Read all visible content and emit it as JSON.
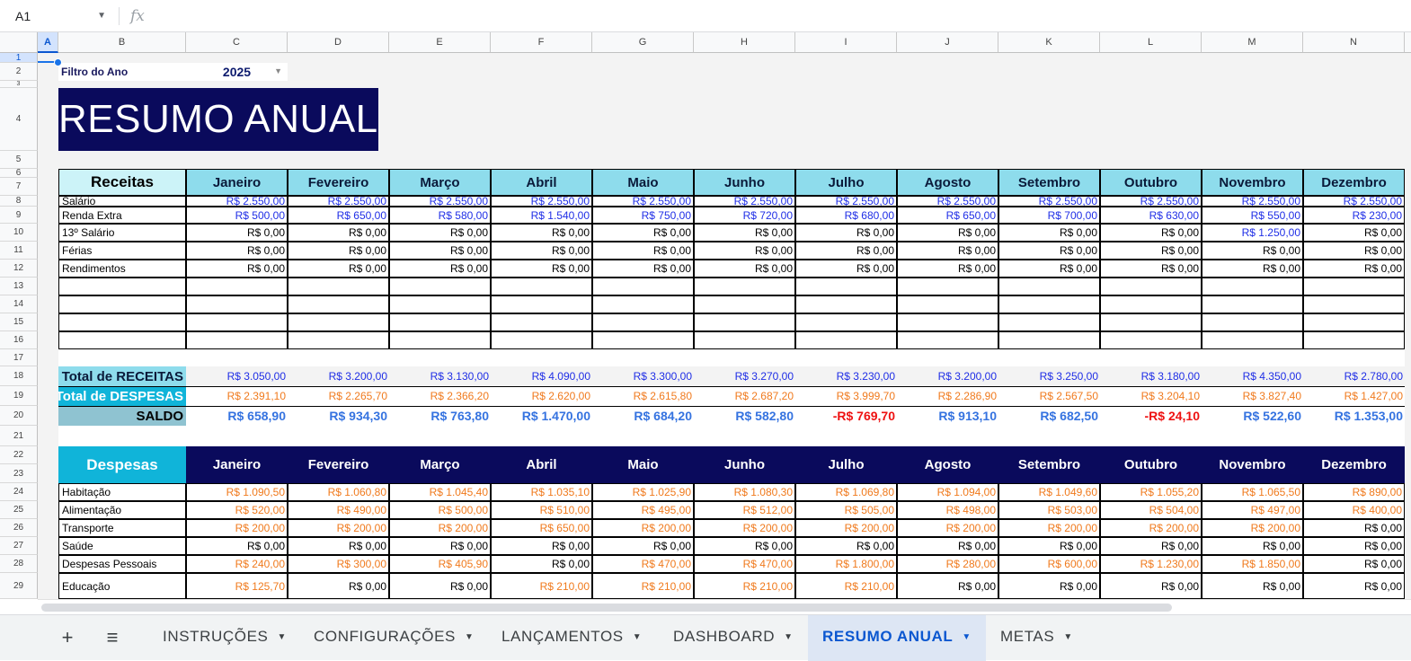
{
  "formula_bar": {
    "cell_ref": "A1",
    "fx_icon": "fx"
  },
  "columns": [
    "A",
    "B",
    "C",
    "D",
    "E",
    "F",
    "G",
    "H",
    "I",
    "J",
    "K",
    "L",
    "M",
    "N"
  ],
  "rows": [
    "1",
    "2",
    "3",
    "4",
    "5",
    "6",
    "7",
    "8",
    "9",
    "10",
    "11",
    "12",
    "13",
    "14",
    "15",
    "16",
    "17",
    "18",
    "19",
    "20",
    "21",
    "22",
    "23",
    "24",
    "25",
    "26",
    "27",
    "28",
    "29"
  ],
  "filter": {
    "label": "Filtro do Ano",
    "value": "2025"
  },
  "title": "RESUMO ANUAL",
  "months": [
    "Janeiro",
    "Fevereiro",
    "Março",
    "Abril",
    "Maio",
    "Junho",
    "Julho",
    "Agosto",
    "Setembro",
    "Outubro",
    "Novembro",
    "Dezembro"
  ],
  "receitas": {
    "header": "Receitas",
    "rows": [
      {
        "label": "Salário",
        "values": [
          "R$ 2.550,00",
          "R$ 2.550,00",
          "R$ 2.550,00",
          "R$ 2.550,00",
          "R$ 2.550,00",
          "R$ 2.550,00",
          "R$ 2.550,00",
          "R$ 2.550,00",
          "R$ 2.550,00",
          "R$ 2.550,00",
          "R$ 2.550,00",
          "R$ 2.550,00"
        ]
      },
      {
        "label": "Renda Extra",
        "values": [
          "R$ 500,00",
          "R$ 650,00",
          "R$ 580,00",
          "R$ 1.540,00",
          "R$ 750,00",
          "R$ 720,00",
          "R$ 680,00",
          "R$ 650,00",
          "R$ 700,00",
          "R$ 630,00",
          "R$ 550,00",
          "R$ 230,00"
        ]
      },
      {
        "label": "13º Salário",
        "values": [
          "R$ 0,00",
          "R$ 0,00",
          "R$ 0,00",
          "R$ 0,00",
          "R$ 0,00",
          "R$ 0,00",
          "R$ 0,00",
          "R$ 0,00",
          "R$ 0,00",
          "R$ 0,00",
          "R$ 1.250,00",
          "R$ 0,00"
        ]
      },
      {
        "label": "Férias",
        "values": [
          "R$ 0,00",
          "R$ 0,00",
          "R$ 0,00",
          "R$ 0,00",
          "R$ 0,00",
          "R$ 0,00",
          "R$ 0,00",
          "R$ 0,00",
          "R$ 0,00",
          "R$ 0,00",
          "R$ 0,00",
          "R$ 0,00"
        ]
      },
      {
        "label": "Rendimentos",
        "values": [
          "R$ 0,00",
          "R$ 0,00",
          "R$ 0,00",
          "R$ 0,00",
          "R$ 0,00",
          "R$ 0,00",
          "R$ 0,00",
          "R$ 0,00",
          "R$ 0,00",
          "R$ 0,00",
          "R$ 0,00",
          "R$ 0,00"
        ]
      }
    ]
  },
  "totals": {
    "receitas_label": "Total de RECEITAS",
    "receitas": [
      "R$ 3.050,00",
      "R$ 3.200,00",
      "R$ 3.130,00",
      "R$ 4.090,00",
      "R$ 3.300,00",
      "R$ 3.270,00",
      "R$ 3.230,00",
      "R$ 3.200,00",
      "R$ 3.250,00",
      "R$ 3.180,00",
      "R$ 4.350,00",
      "R$ 2.780,00"
    ],
    "despesas_label": "Total de DESPESAS",
    "despesas": [
      "R$ 2.391,10",
      "R$ 2.265,70",
      "R$ 2.366,20",
      "R$ 2.620,00",
      "R$ 2.615,80",
      "R$ 2.687,20",
      "R$ 3.999,70",
      "R$ 2.286,90",
      "R$ 2.567,50",
      "R$ 3.204,10",
      "R$ 3.827,40",
      "R$ 1.427,00"
    ],
    "saldo_label": "SALDO",
    "saldo": [
      "R$ 658,90",
      "R$ 934,30",
      "R$ 763,80",
      "R$ 1.470,00",
      "R$ 684,20",
      "R$ 582,80",
      "-R$ 769,70",
      "R$ 913,10",
      "R$ 682,50",
      "-R$ 24,10",
      "R$ 522,60",
      "R$ 1.353,00"
    ]
  },
  "despesas": {
    "header": "Despesas",
    "rows": [
      {
        "label": "Habitação",
        "values": [
          "R$ 1.090,50",
          "R$ 1.060,80",
          "R$ 1.045,40",
          "R$ 1.035,10",
          "R$ 1.025,90",
          "R$ 1.080,30",
          "R$ 1.069,80",
          "R$ 1.094,00",
          "R$ 1.049,60",
          "R$ 1.055,20",
          "R$ 1.065,50",
          "R$ 890,00"
        ]
      },
      {
        "label": "Alimentação",
        "values": [
          "R$ 520,00",
          "R$ 490,00",
          "R$ 500,00",
          "R$ 510,00",
          "R$ 495,00",
          "R$ 512,00",
          "R$ 505,00",
          "R$ 498,00",
          "R$ 503,00",
          "R$ 504,00",
          "R$ 497,00",
          "R$ 400,00"
        ]
      },
      {
        "label": "Transporte",
        "values": [
          "R$ 200,00",
          "R$ 200,00",
          "R$ 200,00",
          "R$ 650,00",
          "R$ 200,00",
          "R$ 200,00",
          "R$ 200,00",
          "R$ 200,00",
          "R$ 200,00",
          "R$ 200,00",
          "R$ 200,00",
          "R$ 0,00"
        ]
      },
      {
        "label": "Saúde",
        "values": [
          "R$ 0,00",
          "R$ 0,00",
          "R$ 0,00",
          "R$ 0,00",
          "R$ 0,00",
          "R$ 0,00",
          "R$ 0,00",
          "R$ 0,00",
          "R$ 0,00",
          "R$ 0,00",
          "R$ 0,00",
          "R$ 0,00"
        ]
      },
      {
        "label": "Despesas Pessoais",
        "values": [
          "R$ 240,00",
          "R$ 300,00",
          "R$ 405,90",
          "R$ 0,00",
          "R$ 470,00",
          "R$ 470,00",
          "R$ 1.800,00",
          "R$ 280,00",
          "R$ 600,00",
          "R$ 1.230,00",
          "R$ 1.850,00",
          "R$ 0,00"
        ]
      },
      {
        "label": "Educação",
        "values": [
          "R$ 125,70",
          "R$ 0,00",
          "R$ 0,00",
          "R$ 210,00",
          "R$ 210,00",
          "R$ 210,00",
          "R$ 210,00",
          "R$ 0,00",
          "R$ 0,00",
          "R$ 0,00",
          "R$ 0,00",
          "R$ 0,00"
        ]
      }
    ]
  },
  "tabs": {
    "add_icon": "+",
    "menu_icon": "≡",
    "items": [
      "INSTRUÇÕES",
      "CONFIGURAÇÕES",
      "LANÇAMENTOS",
      "DASHBOARD",
      "RESUMO ANUAL",
      "METAS"
    ],
    "active": "RESUMO ANUAL"
  },
  "colors": {
    "banner": "#0a0a5c",
    "receitas_header": "#8edcec",
    "despesas_accent": "#10b4d9",
    "income_value": "#1f2ee6",
    "expense_value": "#f07a1d",
    "negative": "#ee1111",
    "saldo": "#3573e0"
  }
}
